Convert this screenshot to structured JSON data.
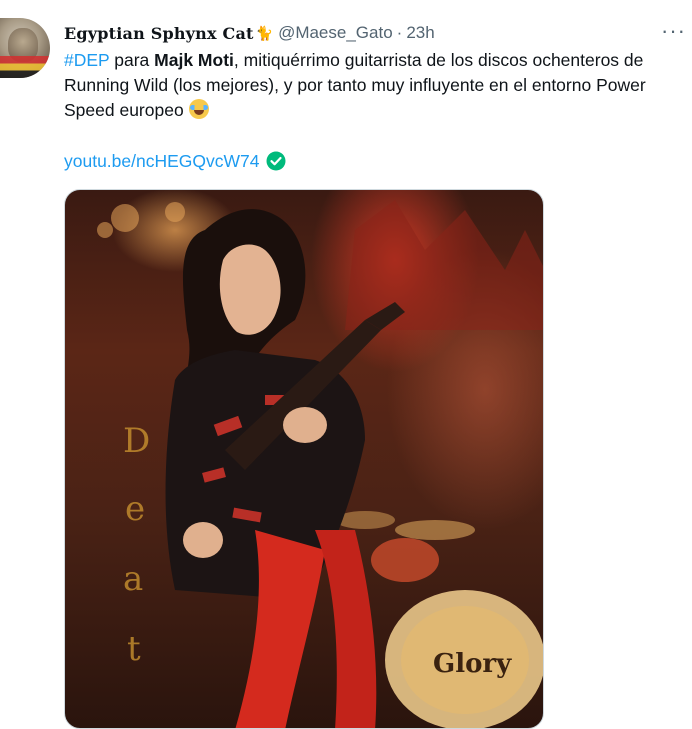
{
  "author": {
    "display_name": "Egyptian Sphynx Cat",
    "name_emoji": "🐈",
    "handle": "@Maese_Gato",
    "separator": "·",
    "time": "23h"
  },
  "more_menu": "···",
  "tweet": {
    "hashtag": "#DEP",
    "text_1": " para ",
    "bold_name": "Majk Moti",
    "text_2": ", mitiquérrimo guitarrista de los discos ochenteros de Running Wild (los mejores), y por tanto muy influyente en el entorno Power Speed europeo ",
    "link": "youtu.be/ncHEGQvcW74"
  },
  "media": {
    "background_letters": [
      "D",
      "e",
      "a",
      "t"
    ],
    "drum_head_text": "Glory"
  },
  "colors": {
    "link": "#1d9bf0",
    "verified": "#00ba7c",
    "secondary_text": "#536471"
  },
  "icons": {
    "verified": "check-circle-icon",
    "more": "more-horizontal-icon"
  }
}
